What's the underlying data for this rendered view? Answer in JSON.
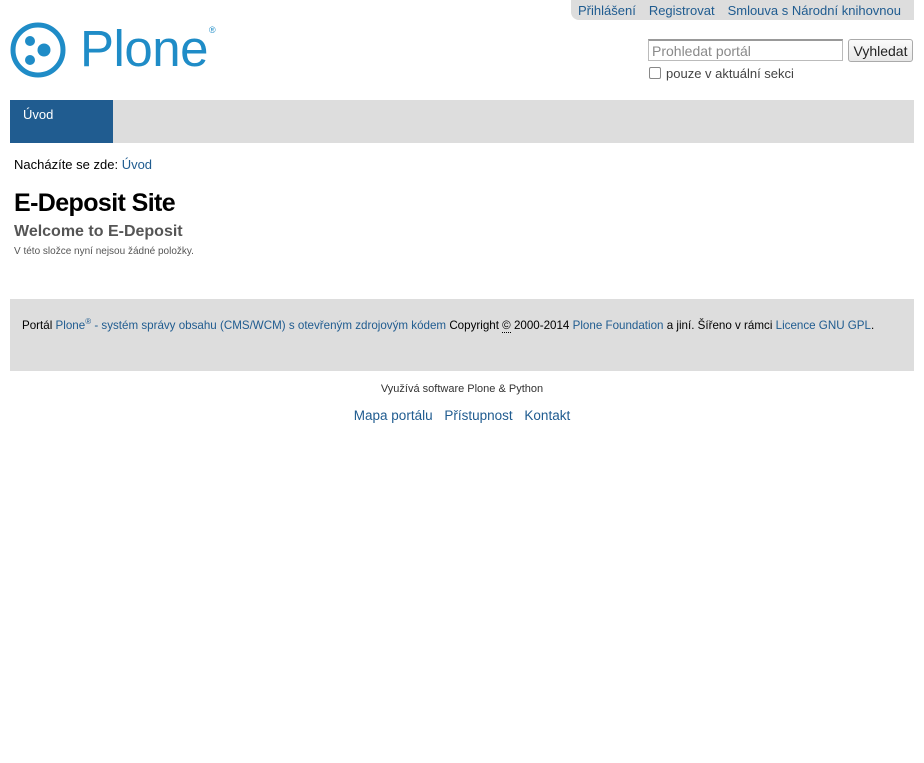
{
  "personal_bar": {
    "items": [
      "Přihlášení",
      "Registrovat",
      "Smlouva s Národní knihovnou"
    ]
  },
  "logo": {
    "text": "Plone",
    "reg": "®",
    "color": "#1f8cc7"
  },
  "search": {
    "placeholder": "Prohledat portál",
    "button_label": "Vyhledat",
    "scope_label": "pouze v aktuální sekci"
  },
  "nav": {
    "tabs": [
      {
        "label": "Úvod",
        "selected": true
      }
    ]
  },
  "breadcrumb": {
    "prefix": "Nacházíte se zde:",
    "link": "Úvod"
  },
  "content": {
    "title": "E-Deposit Site",
    "description": "Welcome to E-Deposit",
    "empty_text": "V této složce nyní nejsou žádné položky."
  },
  "footer": {
    "t1": "Portál",
    "plone": "Plone",
    "reg": "®",
    "plone_desc": " - systém správy obsahu (CMS/WCM) s otevřeným zdrojovým kódem",
    "copyright_word": "Copyright",
    "copyright_symbol": "©",
    "years": " 2000-2014 ",
    "foundation": "Plone Foundation",
    "t2": " a jiní. Šířeno v rámci ",
    "license": "Licence GNU GPL",
    "t3": "."
  },
  "colophon": "Využívá software Plone & Python",
  "site_actions": [
    "Mapa portálu",
    "Přístupnost",
    "Kontakt"
  ],
  "colors": {
    "accent": "#205c90",
    "bar": "#dddddd"
  }
}
